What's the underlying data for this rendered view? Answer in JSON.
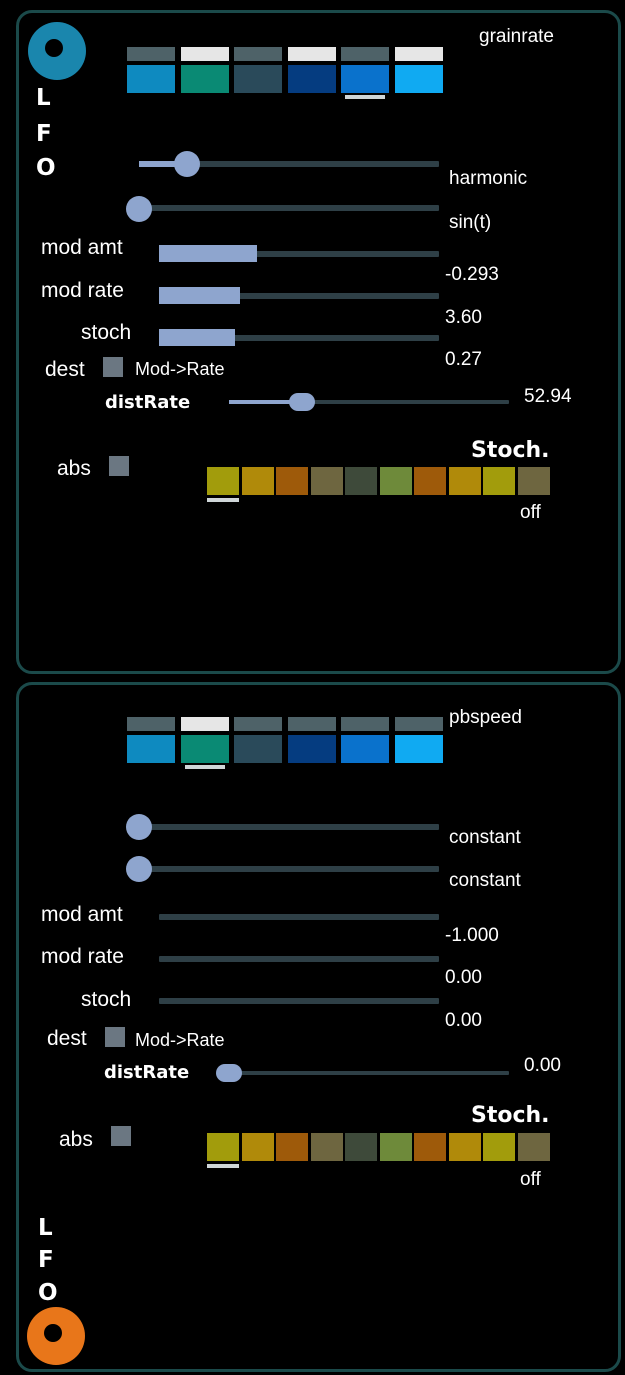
{
  "colors": {
    "panel_border": "#1b4a4a",
    "slider": "#8ea5ce",
    "track": "#2e3f46",
    "lfo1_ring": "#1a86ad",
    "lfo2_ring": "#e8761a"
  },
  "lfo_letters": [
    "L",
    "F",
    "O"
  ],
  "lfo1": {
    "target": "grainrate",
    "shape_label": "harmonic",
    "function_label": "sin(t)",
    "mod_amt_label": "mod amt",
    "mod_amt_value": "-0.293",
    "mod_rate_label": "mod rate",
    "mod_rate_value": "3.60",
    "stoch_label": "stoch",
    "stoch_value": "0.27",
    "dest_label": "dest",
    "dest_value": "Mod->Rate",
    "dist_rate_label": "distRate",
    "dist_rate_value": "52.94",
    "abs_label": "abs",
    "stoch_title": "Stoch.",
    "stoch_mode": "off",
    "selected_swatch": 4,
    "selected_stoch": 0,
    "shape_level": 0.16,
    "function_level": 0.0,
    "mod_amt_level": 0.35,
    "mod_rate_level": 0.29,
    "stoch_level": 0.27,
    "dist_rate_level": 0.26
  },
  "lfo2": {
    "target": "pbspeed",
    "shape_label": "constant",
    "function_label": "constant",
    "mod_amt_label": "mod amt",
    "mod_amt_value": "-1.000",
    "mod_rate_label": "mod rate",
    "mod_rate_value": "0.00",
    "stoch_label": "stoch",
    "stoch_value": "0.00",
    "dest_label": "dest",
    "dest_value": "Mod->Rate",
    "dist_rate_label": "distRate",
    "dist_rate_value": "0.00",
    "abs_label": "abs",
    "stoch_title": "Stoch.",
    "stoch_mode": "off",
    "selected_swatch": 1,
    "selected_stoch": 0,
    "shape_level": 0.0,
    "function_level": 0.0,
    "mod_amt_level": 0.0,
    "mod_rate_level": 0.0,
    "stoch_level": 0.0,
    "dist_rate_level": 0.0
  },
  "swatch_colors": [
    "#0e8ac0",
    "#0a8a74",
    "#2a4a5a",
    "#053c80",
    "#0a72cc",
    "#10aaf2"
  ],
  "swatch_top_colors": [
    "#4e6268",
    "#e6e6e6",
    "#4e6268",
    "#e6e6e6",
    "#4e6268",
    "#e6e6e6"
  ],
  "swatch_top_colors_2": [
    "#4e6268",
    "#e6e6e6",
    "#4e6268",
    "#4e6268",
    "#4e6268",
    "#4e6268"
  ],
  "stoch_colors": [
    "#a29c0c",
    "#b08a0a",
    "#9e5a0a",
    "#6e6640",
    "#3e4a3a",
    "#6e8a3a",
    "#9e5a0a",
    "#b08a0a",
    "#a29c0c",
    "#6e6640"
  ]
}
